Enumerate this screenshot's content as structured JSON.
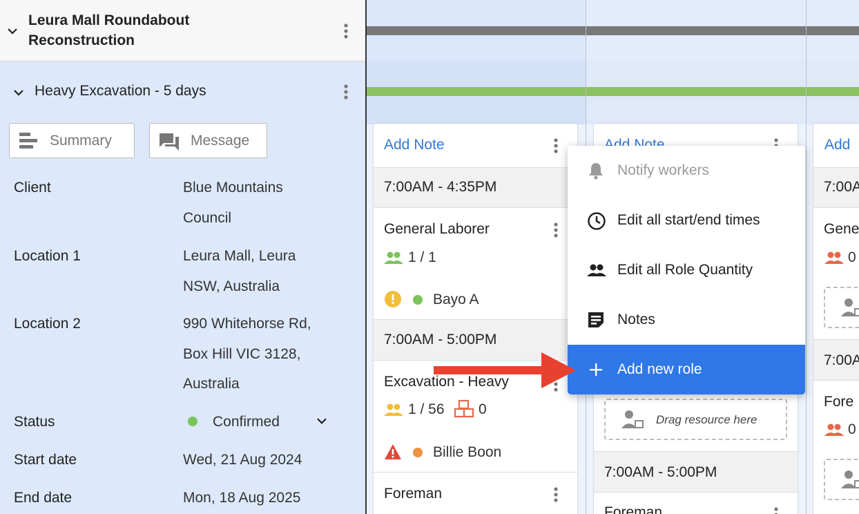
{
  "project": {
    "title": "Leura Mall Roundabout Reconstruction"
  },
  "phase": {
    "title": "Heavy Excavation - 5 days"
  },
  "buttons": {
    "summary": "Summary",
    "message": "Message"
  },
  "details": [
    {
      "label": "Client",
      "value_lines": [
        "Blue Mountains",
        "Council"
      ]
    },
    {
      "label": "Location 1",
      "value_lines": [
        "Leura Mall, Leura",
        "NSW, Australia"
      ]
    },
    {
      "label": "Location 2",
      "value_lines": [
        "990 Whitehorse Rd,",
        "Box Hill VIC 3128,",
        "Australia"
      ]
    },
    {
      "label": "Status",
      "value_lines": [
        "Confirmed"
      ]
    },
    {
      "label": "Start date",
      "value_lines": [
        "Wed, 21 Aug 2024"
      ]
    },
    {
      "label": "End date",
      "value_lines": [
        "Mon, 18 Aug 2025"
      ]
    }
  ],
  "colors": {
    "accent": "#2f78e6",
    "confirmed": "#7cc35a",
    "warning_yellow": "#f2be3a",
    "warning_red": "#e2483b",
    "highlight_arrow": "#e8412f",
    "gantt_gray": "#787878",
    "gantt_green": "#8dc160"
  },
  "columns": [
    {
      "add_note": "Add Note",
      "shifts": [
        {
          "time": "7:00AM - 4:35PM",
          "role": "General Laborer",
          "quantity": "1 / 1",
          "worker": "Bayo A"
        },
        {
          "time": "7:00AM - 5:00PM",
          "role": "Excavation - Heavy",
          "quantity": "1 / 56",
          "equipment": "0",
          "worker": "Billie Boon"
        },
        {
          "role": "Foreman"
        }
      ]
    },
    {
      "add_note": "Add Note",
      "drag_text": "Drag resource here",
      "shifts": [
        {
          "time": "7:00AM - 5:00PM",
          "role": "Foreman"
        }
      ]
    },
    {
      "add_note": "Add",
      "shifts": [
        {
          "time": "7:00A",
          "role": "Gene",
          "quantity": "0"
        },
        {
          "time": "7:00A",
          "role": "Fore",
          "quantity": "0"
        }
      ]
    }
  ],
  "menu": {
    "items": [
      {
        "label": "Notify workers",
        "icon": "bell-icon",
        "disabled": true
      },
      {
        "label": "Edit all start/end times",
        "icon": "clock-icon"
      },
      {
        "label": "Edit all Role Quantity",
        "icon": "people-icon"
      },
      {
        "label": "Notes",
        "icon": "note-icon"
      },
      {
        "label": "Add new role",
        "icon": "plus-icon",
        "active": true
      }
    ]
  }
}
